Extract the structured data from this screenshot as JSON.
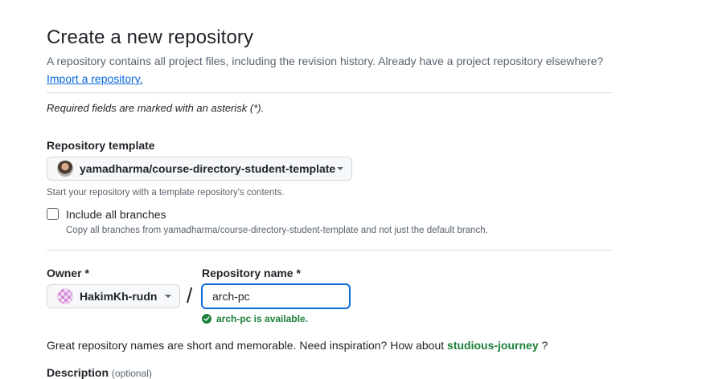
{
  "header": {
    "title": "Create a new repository",
    "subtitle": "A repository contains all project files, including the revision history. Already have a project repository elsewhere?",
    "import_link": "Import a repository."
  },
  "required_note": "Required fields are marked with an asterisk (*).",
  "template": {
    "label": "Repository template",
    "selected": "yamadharma/course-directory-student-template",
    "hint": "Start your repository with a template repository's contents."
  },
  "include_branches": {
    "label": "Include all branches",
    "checked": false,
    "hint": "Copy all branches from yamadharma/course-directory-student-template and not just the default branch."
  },
  "owner": {
    "label": "Owner *",
    "selected": "HakimKh-rudn"
  },
  "repo_name": {
    "label": "Repository name *",
    "value": "arch-pc",
    "availability": "arch-pc is available."
  },
  "separator": "/",
  "inspiration": {
    "text": "Great repository names are short and memorable. Need inspiration? How about ",
    "suggestion": "studious-journey",
    "suffix": " ?"
  },
  "description": {
    "label": "Description",
    "optional": "(optional)"
  },
  "colors": {
    "accent": "#0969da",
    "success": "#1a7f37",
    "border": "#d1d9e0",
    "muted": "#59636e"
  },
  "icons": {
    "template_avatar": "user-photo-avatar",
    "owner_avatar": "identicon-avatar",
    "dropdown": "caret-down-icon",
    "available": "check-circle-icon"
  }
}
